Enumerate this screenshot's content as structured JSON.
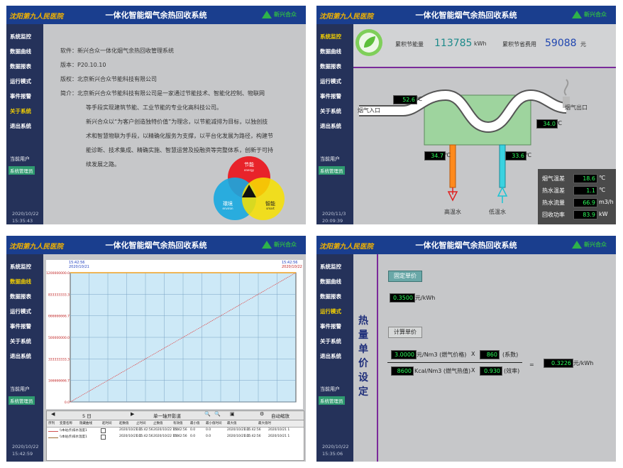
{
  "app": {
    "hospital": "沈阳第九人民医院",
    "title": "一体化智能烟气余热回收系统",
    "brand": "新兴合众"
  },
  "menu": [
    "系统监控",
    "数据曲线",
    "数据报表",
    "运行模式",
    "事件报警",
    "关于系统",
    "退出系统"
  ],
  "user": {
    "label": "当前用户",
    "role": "系统管理员"
  },
  "panel_about": {
    "software": "软件：新兴合众一体化烟气余热回收管理系统",
    "version": "版本：P20.10.10",
    "copyright": "版权：北京新兴合众节能科技有限公司",
    "intro_lines": [
      "简介：北京新兴合众节能科技有限公司是一家通过节能技术、智能化控制、物联网",
      "等手段实现建筑节能、工业节能的专业化高科技公司。",
      "新兴合众以“为客户创造独特价值”为理念，以节能减排为目标，以独创技",
      "术和智慧物联为手段，以精确化服务为支撑，以平台化发展为路径，构建节",
      "能诊断、技术集成、精确实施、智慧运营及投融资等完整体系，创新于可持",
      "续发展之路。"
    ],
    "venn": {
      "top": "节能",
      "top_sub": "energy",
      "left": "環境",
      "left_sub": "environ",
      "right": "智能",
      "right_sub": "smart"
    },
    "datetime": [
      "2020/10/22",
      "15:35:43"
    ]
  },
  "panel_monitor": {
    "saving_label": "累积节能量",
    "saving_value": "113785",
    "saving_unit": "kWh",
    "cost_label": "累积节省费用",
    "cost_value": "59088",
    "cost_unit": "元",
    "inlet_label": "烟气入口",
    "outlet_label": "烟气出口",
    "t_inlet": "52.6",
    "t_outlet": "34.0",
    "t_hot": "34.7",
    "t_cold": "33.6",
    "hot_water": "高温水",
    "cold_water": "低温水",
    "deg": "℃",
    "stats": [
      {
        "label": "烟气温差",
        "value": "18.6",
        "unit": "℃"
      },
      {
        "label": "热水温差",
        "value": "1.1",
        "unit": "℃"
      },
      {
        "label": "热水流量",
        "value": "66.9",
        "unit": "m3/h"
      },
      {
        "label": "回收功率",
        "value": "83.9",
        "unit": "kW"
      }
    ],
    "datetime": [
      "2020/11/3",
      "20:09:39"
    ]
  },
  "panel_curve": {
    "time_left": "15:42:56",
    "date_left": "2020/10/21",
    "time_right": "15:42:56",
    "date_right": "2020/10/22",
    "toolbar": {
      "days": "5 日",
      "axis_mode": "单一轴开影道",
      "auto_scale": "自动缩放"
    },
    "table_headers": [
      "序列",
      "变量名称",
      "隐藏曲线",
      "起时间",
      "起数值",
      "止时间",
      "止数值",
      "有效值",
      "最小值",
      "最小值时间",
      "最大值",
      "最大值时"
    ],
    "rows": [
      [
        "\\\\本站点\\排水温度1",
        "2020/10/21 15:42:56",
        "0.0",
        "2020/10/22 15:42:56",
        "0.0",
        "0.0",
        "0.0",
        "2020/10/21 15:42:56",
        "0.0",
        "2020/10/21 1"
      ],
      [
        "\\\\本站点\\排水温度1",
        "2020/10/21 15:42:56",
        "0.0",
        "2020/10/22 15:42:56",
        "0.0",
        "0.0",
        "0.0",
        "2020/10/21 15:42:56",
        "0.0",
        "2020/10/21 1"
      ]
    ],
    "datetime": [
      "2020/10/22",
      "15:42:59"
    ]
  },
  "chart_data": {
    "type": "line",
    "y_ticks": [
      "1200000000.0",
      "833333333.3",
      "666666666.7",
      "500000000.0",
      "333333333.3",
      "166666666.7",
      "0.0"
    ],
    "ylim": [
      0,
      1200000000
    ],
    "series": [
      {
        "x": [
          0,
          1
        ],
        "values": [
          0,
          1200000000
        ],
        "color": "#e04848"
      }
    ],
    "grid": true
  },
  "panel_price": {
    "vertical_title": [
      "热",
      "量",
      "单",
      "价",
      "设",
      "定"
    ],
    "fixed_btn": "固定单价",
    "fixed_value": "0.3500",
    "fixed_unit": "元/kWh",
    "calc_btn": "计算单价",
    "gas_price": "3.0000",
    "gas_unit": "元/Nm3 (燃气价格)",
    "x1": "X",
    "coef": "860",
    "coef_label": "(系数)",
    "heat_value": "8600",
    "heat_unit": "Kcal/Nm3 (燃气热值)",
    "x2": "X",
    "eff": "0.930",
    "eff_label": "(效率)",
    "eq": "=",
    "result": "0.3226",
    "result_unit": "元/kWh",
    "datetime": [
      "2020/10/22",
      "15:35:06"
    ]
  }
}
